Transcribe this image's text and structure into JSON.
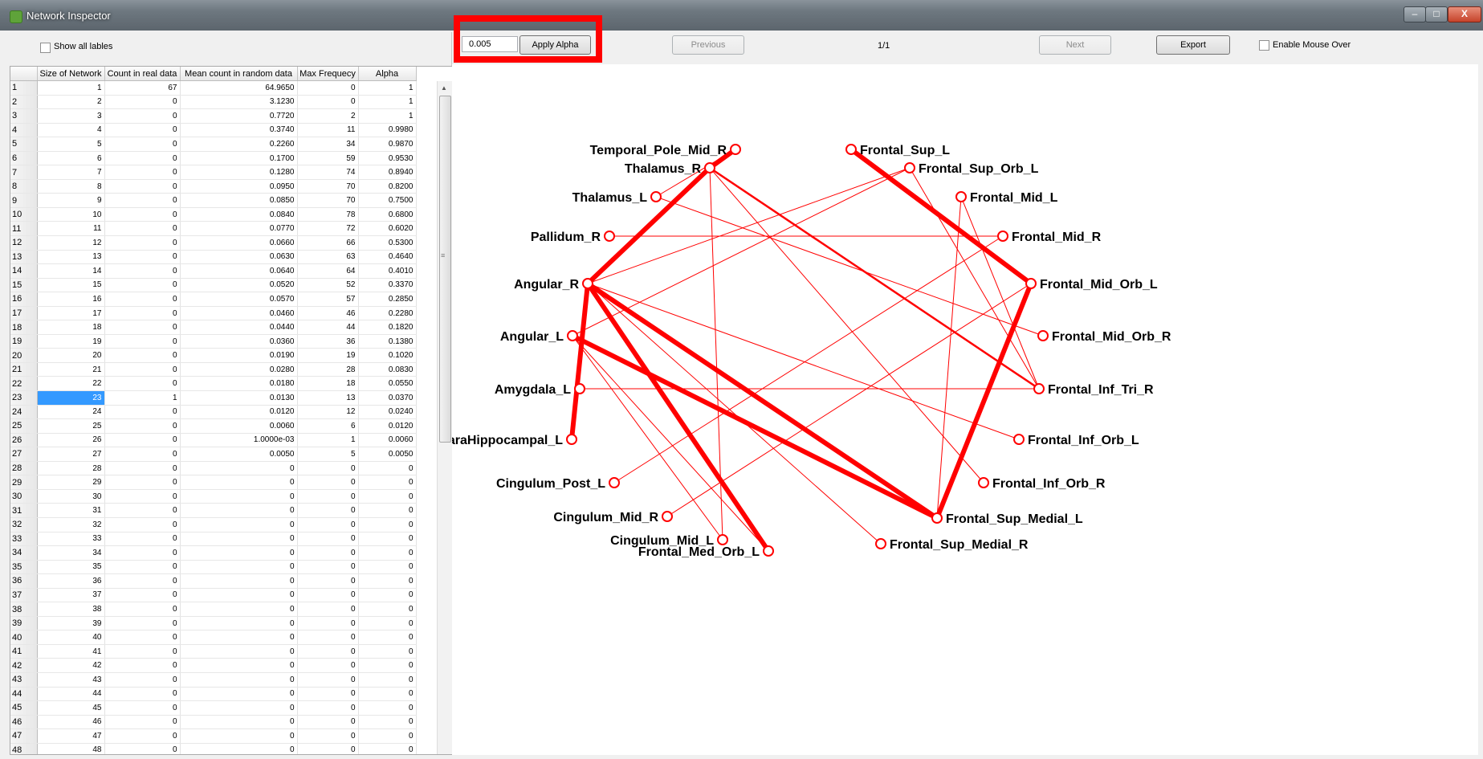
{
  "window": {
    "title": "Network Inspector",
    "min_glyph": "–",
    "max_glyph": "□",
    "close_glyph": "X"
  },
  "left": {
    "show_all_labels": "Show all lables",
    "table": {
      "columns": [
        "Size of Network",
        "Count in real data",
        "Mean count in random data",
        "Max Frequecy",
        "Alpha"
      ],
      "selected_row": 23,
      "rows": [
        [
          "1",
          "67",
          "64.9650",
          "0",
          "1"
        ],
        [
          "2",
          "0",
          "3.1230",
          "0",
          "1"
        ],
        [
          "3",
          "0",
          "0.7720",
          "2",
          "1"
        ],
        [
          "4",
          "0",
          "0.3740",
          "11",
          "0.9980"
        ],
        [
          "5",
          "0",
          "0.2260",
          "34",
          "0.9870"
        ],
        [
          "6",
          "0",
          "0.1700",
          "59",
          "0.9530"
        ],
        [
          "7",
          "0",
          "0.1280",
          "74",
          "0.8940"
        ],
        [
          "8",
          "0",
          "0.0950",
          "70",
          "0.8200"
        ],
        [
          "9",
          "0",
          "0.0850",
          "70",
          "0.7500"
        ],
        [
          "10",
          "0",
          "0.0840",
          "78",
          "0.6800"
        ],
        [
          "11",
          "0",
          "0.0770",
          "72",
          "0.6020"
        ],
        [
          "12",
          "0",
          "0.0660",
          "66",
          "0.5300"
        ],
        [
          "13",
          "0",
          "0.0630",
          "63",
          "0.4640"
        ],
        [
          "14",
          "0",
          "0.0640",
          "64",
          "0.4010"
        ],
        [
          "15",
          "0",
          "0.0520",
          "52",
          "0.3370"
        ],
        [
          "16",
          "0",
          "0.0570",
          "57",
          "0.2850"
        ],
        [
          "17",
          "0",
          "0.0460",
          "46",
          "0.2280"
        ],
        [
          "18",
          "0",
          "0.0440",
          "44",
          "0.1820"
        ],
        [
          "19",
          "0",
          "0.0360",
          "36",
          "0.1380"
        ],
        [
          "20",
          "0",
          "0.0190",
          "19",
          "0.1020"
        ],
        [
          "21",
          "0",
          "0.0280",
          "28",
          "0.0830"
        ],
        [
          "22",
          "0",
          "0.0180",
          "18",
          "0.0550"
        ],
        [
          "23",
          "1",
          "0.0130",
          "13",
          "0.0370"
        ],
        [
          "24",
          "0",
          "0.0120",
          "12",
          "0.0240"
        ],
        [
          "25",
          "0",
          "0.0060",
          "6",
          "0.0120"
        ],
        [
          "26",
          "0",
          "1.0000e-03",
          "1",
          "0.0060"
        ],
        [
          "27",
          "0",
          "0.0050",
          "5",
          "0.0050"
        ],
        [
          "28",
          "0",
          "0",
          "0",
          "0"
        ],
        [
          "29",
          "0",
          "0",
          "0",
          "0"
        ],
        [
          "30",
          "0",
          "0",
          "0",
          "0"
        ],
        [
          "31",
          "0",
          "0",
          "0",
          "0"
        ],
        [
          "32",
          "0",
          "0",
          "0",
          "0"
        ],
        [
          "33",
          "0",
          "0",
          "0",
          "0"
        ],
        [
          "34",
          "0",
          "0",
          "0",
          "0"
        ],
        [
          "35",
          "0",
          "0",
          "0",
          "0"
        ],
        [
          "36",
          "0",
          "0",
          "0",
          "0"
        ],
        [
          "37",
          "0",
          "0",
          "0",
          "0"
        ],
        [
          "38",
          "0",
          "0",
          "0",
          "0"
        ],
        [
          "39",
          "0",
          "0",
          "0",
          "0"
        ],
        [
          "40",
          "0",
          "0",
          "0",
          "0"
        ],
        [
          "41",
          "0",
          "0",
          "0",
          "0"
        ],
        [
          "42",
          "0",
          "0",
          "0",
          "0"
        ],
        [
          "43",
          "0",
          "0",
          "0",
          "0"
        ],
        [
          "44",
          "0",
          "0",
          "0",
          "0"
        ],
        [
          "45",
          "0",
          "0",
          "0",
          "0"
        ],
        [
          "46",
          "0",
          "0",
          "0",
          "0"
        ],
        [
          "47",
          "0",
          "0",
          "0",
          "0"
        ],
        [
          "48",
          "0",
          "0",
          "0",
          "0"
        ]
      ]
    }
  },
  "toolbar": {
    "alpha_value": "0.005",
    "apply_alpha": "Apply Alpha",
    "previous": "Previous",
    "page": "1/1",
    "next": "Next",
    "export": "Export",
    "mouse_over": "Enable Mouse Over"
  },
  "graph": {
    "edge_color": "#ff0000",
    "nodes": [
      "Temporal_Pole_Mid_R",
      "Thalamus_R",
      "Thalamus_L",
      "Pallidum_R",
      "Angular_R",
      "Angular_L",
      "Amygdala_L",
      "ParaHippocampal_L",
      "Cingulum_Post_L",
      "Cingulum_Mid_R",
      "Cingulum_Mid_L",
      "Frontal_Med_Orb_L",
      "Frontal_Sup_L",
      "Frontal_Sup_Orb_L",
      "Frontal_Mid_L",
      "Frontal_Mid_R",
      "Frontal_Mid_Orb_L",
      "Frontal_Mid_Orb_R",
      "Frontal_Inf_Tri_R",
      "Frontal_Inf_Orb_L",
      "Frontal_Inf_Orb_R",
      "Frontal_Sup_Medial_L",
      "Frontal_Sup_Medial_R"
    ],
    "edges": [
      [
        "Temporal_Pole_Mid_R",
        "Thalamus_R",
        "thick"
      ],
      [
        "Thalamus_R",
        "Angular_R",
        "thick"
      ],
      [
        "Angular_R",
        "ParaHippocampal_L",
        "thick"
      ],
      [
        "Angular_R",
        "Frontal_Med_Orb_L",
        "thick"
      ],
      [
        "Angular_R",
        "Frontal_Sup_Medial_L",
        "thick"
      ],
      [
        "Angular_L",
        "Frontal_Sup_Medial_L",
        "thick"
      ],
      [
        "Frontal_Sup_Medial_L",
        "Frontal_Mid_Orb_L",
        "thick"
      ],
      [
        "Frontal_Sup_L",
        "Frontal_Mid_Orb_L",
        "thick"
      ],
      [
        "Thalamus_R",
        "Frontal_Inf_Tri_R",
        "medium"
      ],
      [
        "Temporal_Pole_Mid_R",
        "Thalamus_L",
        "thin"
      ],
      [
        "Thalamus_R",
        "Cingulum_Mid_L",
        "thin"
      ],
      [
        "Thalamus_R",
        "Frontal_Inf_Orb_R",
        "thin"
      ],
      [
        "Thalamus_L",
        "Frontal_Mid_Orb_R",
        "thin"
      ],
      [
        "Pallidum_R",
        "Frontal_Mid_R",
        "thin"
      ],
      [
        "Angular_R",
        "Frontal_Sup_Orb_L",
        "thin"
      ],
      [
        "Angular_R",
        "Frontal_Inf_Orb_L",
        "thin"
      ],
      [
        "Angular_R",
        "Frontal_Sup_Medial_R",
        "thin"
      ],
      [
        "Angular_L",
        "Frontal_Sup_Orb_L",
        "thin"
      ],
      [
        "Angular_L",
        "Frontal_Med_Orb_L",
        "thin"
      ],
      [
        "Angular_L",
        "Cingulum_Mid_L",
        "thin"
      ],
      [
        "Amygdala_L",
        "Frontal_Inf_Tri_R",
        "thin"
      ],
      [
        "Cingulum_Post_L",
        "Frontal_Mid_R",
        "thin"
      ],
      [
        "Cingulum_Mid_R",
        "Frontal_Mid_Orb_L",
        "thin"
      ],
      [
        "Frontal_Mid_L",
        "Frontal_Inf_Tri_R",
        "thin"
      ],
      [
        "Frontal_Mid_L",
        "Frontal_Sup_Medial_L",
        "thin"
      ],
      [
        "Frontal_Sup_Orb_L",
        "Frontal_Inf_Tri_R",
        "thin"
      ]
    ]
  }
}
